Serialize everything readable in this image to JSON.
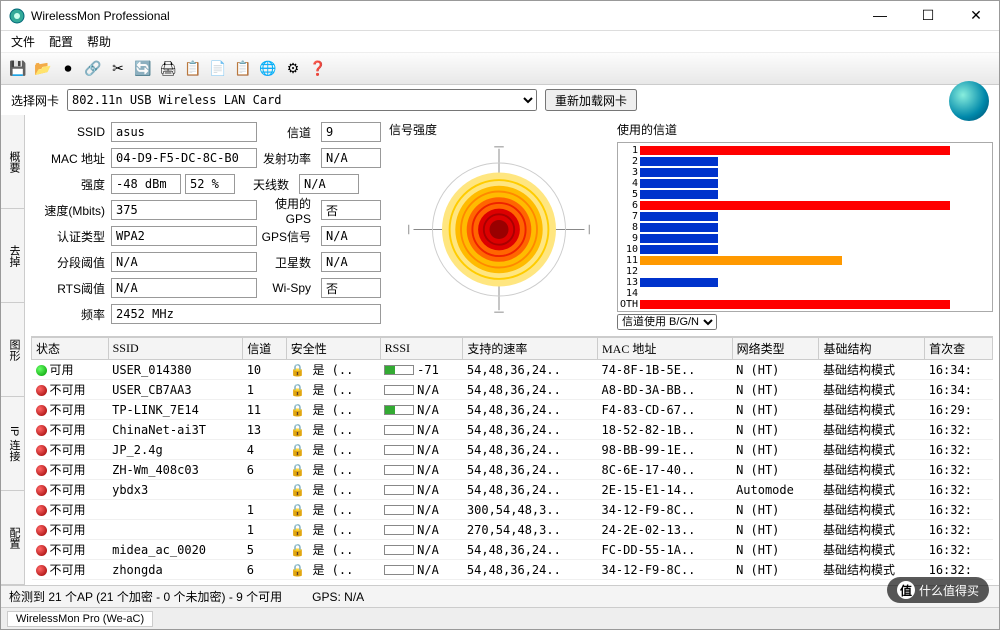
{
  "window": {
    "title": "WirelessMon Professional"
  },
  "menu": {
    "file": "文件",
    "config": "配置",
    "help": "帮助"
  },
  "nic": {
    "label": "选择网卡",
    "value": "802.11n USB Wireless LAN Card",
    "reload": "重新加载网卡"
  },
  "vtabs": [
    "概要",
    "去掉",
    "图形",
    "IP 连接",
    "配置"
  ],
  "fields": {
    "ssid_l": "SSID",
    "ssid": "asus",
    "chan_l": "信道",
    "chan": "9",
    "mac_l": "MAC 地址",
    "mac": "04-D9-F5-DC-8C-B0",
    "txp_l": "发射功率",
    "txp": "N/A",
    "str_l": "强度",
    "str": "-48 dBm",
    "str_pct": "52 %",
    "ant_l": "天线数",
    "ant": "N/A",
    "spd_l": "速度(Mbits)",
    "spd": "375",
    "gps_l": "使用的GPS",
    "gps": "否",
    "auth_l": "认证类型",
    "auth": "WPA2",
    "gpss_l": "GPS信号",
    "gpss": "N/A",
    "frag_l": "分段阈值",
    "frag": "N/A",
    "sat_l": "卫星数",
    "sat": "N/A",
    "rts_l": "RTS阈值",
    "rts": "N/A",
    "wispy_l": "Wi-Spy",
    "wispy": "否",
    "freq_l": "频率",
    "freq": "2452 MHz"
  },
  "sig_title": "信号强度",
  "ch_title": "使用的信道",
  "ch_sel_label": "信道使用 B/G/N",
  "chart_data": {
    "type": "bar",
    "title": "使用的信道",
    "xlabel": "",
    "ylabel": "信道",
    "categories": [
      1,
      2,
      3,
      4,
      5,
      6,
      7,
      8,
      9,
      10,
      11,
      12,
      13,
      14,
      "OTH"
    ],
    "series": [
      {
        "name": "red",
        "color": "#ff0000",
        "values": [
          100,
          0,
          0,
          0,
          0,
          100,
          0,
          0,
          0,
          0,
          0,
          0,
          0,
          0,
          100
        ]
      },
      {
        "name": "blue",
        "color": "#0033cc",
        "values": [
          0,
          25,
          25,
          25,
          25,
          0,
          25,
          25,
          25,
          25,
          0,
          0,
          25,
          0,
          0
        ]
      },
      {
        "name": "orange",
        "color": "#ff9900",
        "values": [
          0,
          0,
          0,
          0,
          0,
          0,
          0,
          0,
          0,
          0,
          65,
          0,
          0,
          0,
          0
        ]
      }
    ]
  },
  "cols": {
    "status": "状态",
    "ssid": "SSID",
    "chan": "信道",
    "sec": "安全性",
    "rssi": "RSSI",
    "rates": "支持的速率",
    "mac": "MAC 地址",
    "net": "网络类型",
    "infra": "基础结构",
    "first": "首次查"
  },
  "rows": [
    {
      "st": "g",
      "stt": "可用",
      "ssid": "USER_014380",
      "ch": "10",
      "sec": "是 (..",
      "rssi": "-71",
      "rf": 35,
      "rates": "54,48,36,24..",
      "mac": "74-8F-1B-5E..",
      "net": "N (HT)",
      "infra": "基础结构模式",
      "t": "16:34:"
    },
    {
      "st": "r",
      "stt": "不可用",
      "ssid": "USER_CB7AA3",
      "ch": "1",
      "sec": "是 (..",
      "rssi": "N/A",
      "rf": 0,
      "rates": "54,48,36,24..",
      "mac": "A8-BD-3A-BB..",
      "net": "N (HT)",
      "infra": "基础结构模式",
      "t": "16:34:"
    },
    {
      "st": "r",
      "stt": "不可用",
      "ssid": "TP-LINK_7E14",
      "ch": "11",
      "sec": "是 (..",
      "rssi": "N/A",
      "rf": 35,
      "rates": "54,48,36,24..",
      "mac": "F4-83-CD-67..",
      "net": "N (HT)",
      "infra": "基础结构模式",
      "t": "16:29:"
    },
    {
      "st": "r",
      "stt": "不可用",
      "ssid": "ChinaNet-ai3T",
      "ch": "13",
      "sec": "是 (..",
      "rssi": "N/A",
      "rf": 0,
      "rates": "54,48,36,24..",
      "mac": "18-52-82-1B..",
      "net": "N (HT)",
      "infra": "基础结构模式",
      "t": "16:32:"
    },
    {
      "st": "r",
      "stt": "不可用",
      "ssid": "JP_2.4g",
      "ch": "4",
      "sec": "是 (..",
      "rssi": "N/A",
      "rf": 0,
      "rates": "54,48,36,24..",
      "mac": "98-BB-99-1E..",
      "net": "N (HT)",
      "infra": "基础结构模式",
      "t": "16:32:"
    },
    {
      "st": "r",
      "stt": "不可用",
      "ssid": "ZH-Wm_408c03",
      "ch": "6",
      "sec": "是 (..",
      "rssi": "N/A",
      "rf": 0,
      "rates": "54,48,36,24..",
      "mac": "8C-6E-17-40..",
      "net": "N (HT)",
      "infra": "基础结构模式",
      "t": "16:32:"
    },
    {
      "st": "r",
      "stt": "不可用",
      "ssid": "ybdx3",
      "ch": "",
      "sec": "是 (..",
      "rssi": "N/A",
      "rf": 0,
      "rates": "54,48,36,24..",
      "mac": "2E-15-E1-14..",
      "net": "Automode",
      "infra": "基础结构模式",
      "t": "16:32:"
    },
    {
      "st": "r",
      "stt": "不可用",
      "ssid": "",
      "ch": "1",
      "sec": "是 (..",
      "rssi": "N/A",
      "rf": 0,
      "rates": "300,54,48,3..",
      "mac": "34-12-F9-8C..",
      "net": "N (HT)",
      "infra": "基础结构模式",
      "t": "16:32:"
    },
    {
      "st": "r",
      "stt": "不可用",
      "ssid": "",
      "ch": "1",
      "sec": "是 (..",
      "rssi": "N/A",
      "rf": 0,
      "rates": "270,54,48,3..",
      "mac": "24-2E-02-13..",
      "net": "N (HT)",
      "infra": "基础结构模式",
      "t": "16:32:"
    },
    {
      "st": "r",
      "stt": "不可用",
      "ssid": "midea_ac_0020",
      "ch": "5",
      "sec": "是 (..",
      "rssi": "N/A",
      "rf": 0,
      "rates": "54,48,36,24..",
      "mac": "FC-DD-55-1A..",
      "net": "N (HT)",
      "infra": "基础结构模式",
      "t": "16:32:"
    },
    {
      "st": "r",
      "stt": "不可用",
      "ssid": "zhongda",
      "ch": "6",
      "sec": "是 (..",
      "rssi": "N/A",
      "rf": 0,
      "rates": "54,48,36,24..",
      "mac": "34-12-F9-8C..",
      "net": "N (HT)",
      "infra": "基础结构模式",
      "t": "16:32:"
    }
  ],
  "status": {
    "aps": "检测到 21 个AP (21 个加密 - 0 个未加密) - 9 个可用",
    "gps": "GPS: N/A"
  },
  "watermark": "什么值得买",
  "taskbar": "WirelessMon Pro (We-aC)"
}
